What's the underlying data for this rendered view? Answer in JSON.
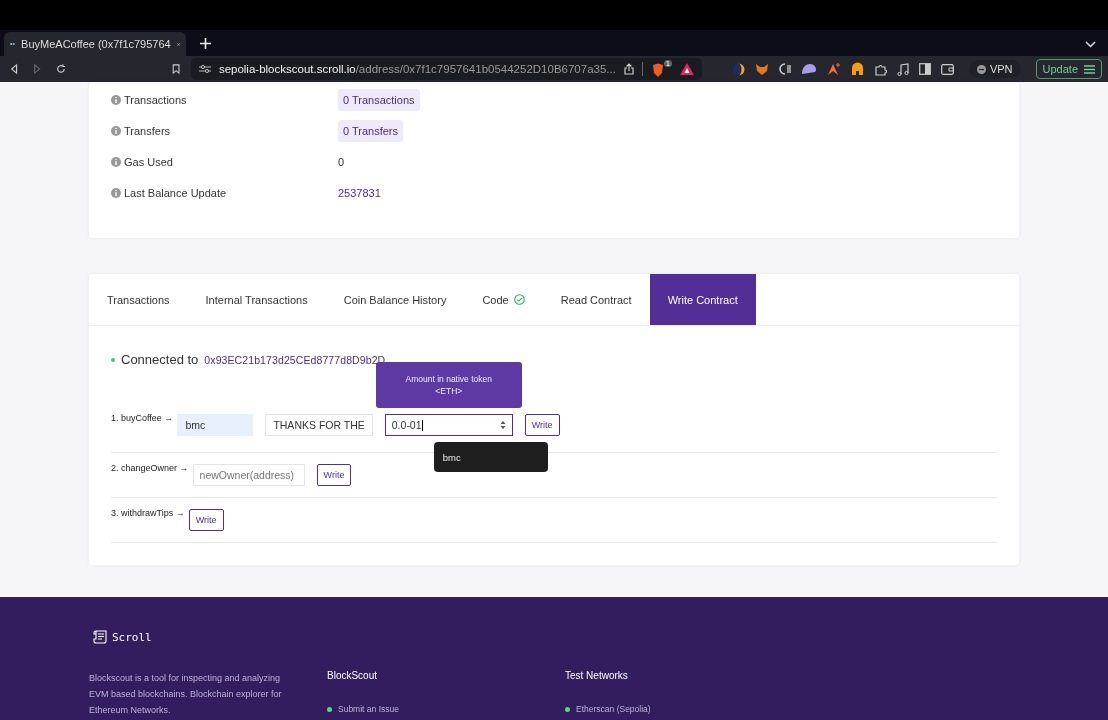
{
  "browser": {
    "tab": {
      "title": "BuyMeACoffee (0x7f1c795764",
      "selected": true
    },
    "url": {
      "host": "sepolia-blockscout.scroll.io",
      "path": "/address/0x7f1c7957641b0544252D10B6707a35..."
    },
    "shields_count": "1",
    "vpn_label": "VPN",
    "update_label": "Update"
  },
  "details": [
    {
      "label": "Transactions",
      "value": "0 Transactions",
      "kind": "chip"
    },
    {
      "label": "Transfers",
      "value": "0 Transfers",
      "kind": "chip"
    },
    {
      "label": "Gas Used",
      "value": "0",
      "kind": "plain"
    },
    {
      "label": "Last Balance Update",
      "value": "2537831",
      "kind": "link"
    }
  ],
  "tabs": [
    {
      "label": "Transactions",
      "selected": false,
      "verified": false
    },
    {
      "label": "Internal Transactions",
      "selected": false,
      "verified": false
    },
    {
      "label": "Coin Balance History",
      "selected": false,
      "verified": false
    },
    {
      "label": "Code",
      "selected": false,
      "verified": true
    },
    {
      "label": "Read Contract",
      "selected": false,
      "verified": false
    },
    {
      "label": "Write Contract",
      "selected": true,
      "verified": false
    }
  ],
  "connection": {
    "label": "Connected to",
    "address": "0x93EC21b173d25CEd8777d8D9b2D",
    "connected": true
  },
  "methods": [
    {
      "name": "1. buyCoffee",
      "arrow": "→",
      "inputs": [
        {
          "value": "bmc",
          "autofilled": true,
          "kind": "text"
        },
        {
          "value": "THANKS FOR THE",
          "autofilled": false,
          "kind": "text"
        },
        {
          "value": "0.0-01",
          "kind": "number"
        }
      ],
      "button": "Write"
    },
    {
      "name": "2. changeOwner",
      "arrow": "→",
      "inputs": [
        {
          "placeholder": "newOwner(address)",
          "kind": "text"
        }
      ],
      "button": "Write"
    },
    {
      "name": "3. withdrawTips",
      "arrow": "→",
      "button": "Write"
    }
  ],
  "tooltip": {
    "lines": [
      "Amount in native token",
      "<ETH>"
    ]
  },
  "autocomplete": {
    "items": [
      "bmc"
    ]
  },
  "footer": {
    "logo": "Scroll",
    "description": "Blockscout is a tool for inspecting and analyzing EVM based blockchains. Blockchain explorer for Ethereum Networks.",
    "columns": [
      {
        "title": "BlockScout",
        "links": [
          "Submit an Issue"
        ]
      },
      {
        "title": "Test Networks",
        "links": [
          "Etherscan (Sepolia)"
        ]
      }
    ]
  }
}
